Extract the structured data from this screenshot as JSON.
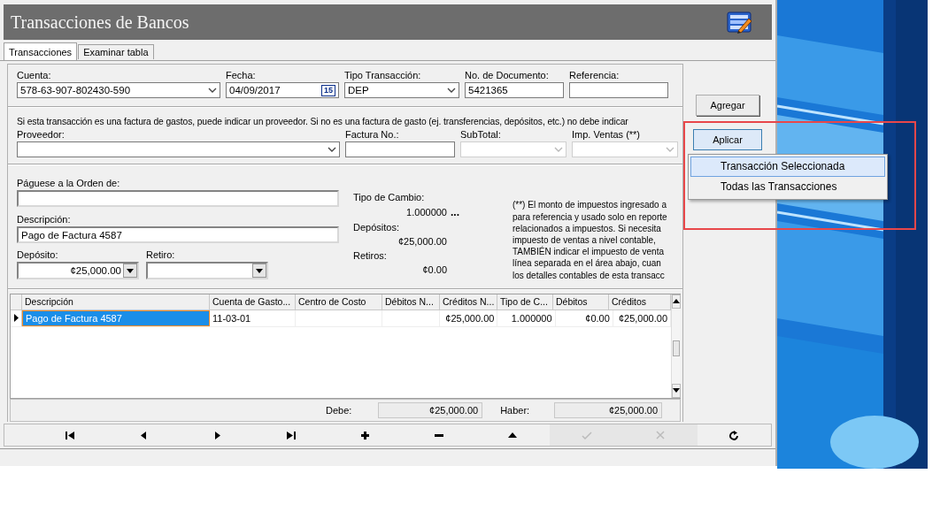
{
  "window": {
    "title": "Transacciones de Bancos"
  },
  "tabs": [
    {
      "label": "Transacciones",
      "selected": true
    },
    {
      "label": "Examinar tabla",
      "selected": false
    }
  ],
  "header_fields": [
    {
      "kind": "combo",
      "label": "Cuenta:",
      "value": "578-63-907-802430-590"
    },
    {
      "kind": "date",
      "label": "Fecha:",
      "value": "04/09/2017",
      "calendar": "15"
    },
    {
      "kind": "combo",
      "label": "Tipo Transacción:",
      "value": "DEP"
    },
    {
      "kind": "text",
      "label": "No. de Documento:",
      "value": "5421365"
    },
    {
      "kind": "text",
      "label": "Referencia:"
    }
  ],
  "supplier_note": "Si esta transacción es una factura de gastos, puede indicar un proveedor. Si no es una factura de gasto (ej. transferencias, depósitos, etc.) no debe indicar",
  "supplier_fields": [
    {
      "kind": "combo",
      "label": "Proveedor:",
      "disabled": false
    },
    {
      "kind": "text",
      "label": "Factura No.:",
      "disabled": false
    },
    {
      "kind": "combo",
      "label": "SubTotal:",
      "disabled": true
    },
    {
      "kind": "combo",
      "label": "Imp. Ventas (**)",
      "disabled": true
    }
  ],
  "payee": {
    "label": "Páguese a la Orden de:"
  },
  "description": {
    "label": "Descripción:",
    "value": "Pago de Factura 4587"
  },
  "amount_fields": [
    {
      "label": "Depósito:",
      "value": "¢25,000.00"
    },
    {
      "label": "Retiro:"
    }
  ],
  "summary": {
    "exchange_label": "Tipo de Cambio:",
    "exchange_value": "1.000000",
    "exchange_button": "...",
    "deposits_label": "Depósitos:",
    "deposits_value": "¢25,000.00",
    "withdrawals_label": "Retiros:",
    "withdrawals_value": "¢0.00"
  },
  "tax_note_lines": [
    "(**) El monto de impuestos ingresado a",
    "para referencia y usado solo en reporte",
    "relacionados a impuestos. Si necesita",
    "impuesto de ventas a nivel contable,",
    "TAMBIÉN indicar el impuesto de venta",
    "línea separada en el área abajo, cuan",
    "los detalles contables de esta transacc"
  ],
  "grid": {
    "columns": [
      "Descripción",
      "Cuenta de Gasto...",
      "Centro de Costo",
      "Débitos N...",
      "Créditos N...",
      "Tipo de C...",
      "Débitos",
      "Créditos"
    ],
    "rows": [
      {
        "selected": true,
        "cells": [
          "Pago de Factura 4587",
          "11-03-01",
          null,
          null,
          "¢25,000.00",
          "1.000000",
          "¢0.00",
          "¢25,000.00"
        ]
      }
    ]
  },
  "totals": {
    "debit_label": "Debe:",
    "debit_value": "¢25,000.00",
    "credit_label": "Haber:",
    "credit_value": "¢25,000.00"
  },
  "navigator": [
    {
      "kind": "first",
      "disabled": false
    },
    {
      "kind": "prior",
      "disabled": false
    },
    {
      "kind": "next",
      "disabled": false
    },
    {
      "kind": "last",
      "disabled": false
    },
    {
      "kind": "insert",
      "disabled": false
    },
    {
      "kind": "delete",
      "disabled": false
    },
    {
      "kind": "edit",
      "disabled": false
    },
    {
      "kind": "post",
      "disabled": true
    },
    {
      "kind": "cancel",
      "disabled": true
    },
    {
      "kind": "refresh",
      "disabled": false
    }
  ],
  "buttons": [
    {
      "label": "Agregar",
      "pressed": false
    },
    {
      "label": "Aplicar",
      "pressed": true
    }
  ],
  "apply_menu": [
    {
      "label": "Transacción Seleccionada",
      "selected": true
    },
    {
      "label": "Todas las Transacciones",
      "selected": false
    }
  ]
}
